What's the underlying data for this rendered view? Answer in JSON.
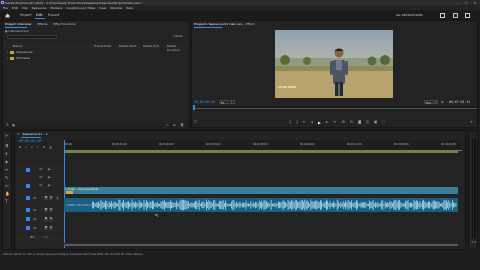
{
  "window": {
    "title": "Adobe Premiere Pro 2023 - C:\\Users\\Lady Productions\\Desktop\\Interview\\Project\\Interview *",
    "minimize": "—",
    "maximize": "☐",
    "close": "✕"
  },
  "menu": [
    "File",
    "Edit",
    "Clip",
    "Sequence",
    "Markers",
    "Graphics and Titles",
    "View",
    "Window",
    "Help"
  ],
  "workspace": {
    "tabs": [
      "Import",
      "Edit",
      "Export"
    ],
    "active": "Edit",
    "project_label": "ALL PRODUCTIONS"
  },
  "project_panel": {
    "tabs": [
      "Project: Interview",
      "Effects",
      "Effect Controls"
    ],
    "project_file": "Interview.prproj",
    "search_placeholder": "",
    "item_count": "2 Items",
    "columns": [
      "Name",
      "Frame Rate",
      "Media Start",
      "Media End",
      "Media Duration"
    ],
    "items": [
      {
        "name": "Sequences"
      },
      {
        "name": "iPhoneAu"
      }
    ]
  },
  "program_monitor": {
    "tab_title": "Program: Sequence 01",
    "tab_menu": "≡",
    "source_tab": "Interview - Effect",
    "timecode_left": "00;00;00;00",
    "fit": "Fit",
    "quality": "Full",
    "timecode_right": "00;07:03:13",
    "overlay_text": "LTTOR HONS"
  },
  "timeline": {
    "tab_title": "Sequence 01",
    "timecode": "00;00;00;00",
    "ruler_marks": [
      "00;00",
      "00;00;32;00",
      "00;01;04;02",
      "00;01;36;02",
      "00;02;08;04",
      "00;02;40;04",
      "00;03;12;06",
      "00;03;44;06",
      "00;04;16;08",
      "00;04;48;08"
    ],
    "tracks": [
      {
        "name": "V3",
        "target": "V3"
      },
      {
        "name": "V2",
        "target": "V2"
      },
      {
        "name": "V1",
        "target": "V1"
      },
      {
        "name": "A1",
        "target": "A1"
      },
      {
        "name": "A2",
        "target": "A2"
      },
      {
        "name": "A3",
        "target": "A3"
      },
      {
        "name": "A4",
        "target": "A4"
      },
      {
        "name": "Mix",
        "target": ""
      }
    ],
    "video_clip_label": "1 Dollar - Interview(2019)",
    "mix_value": "0.0"
  },
  "statusbar": {
    "text": "Click to select, or click in empty space and drag to marquee select. Use Shift, Alt, and Ctrl for other options."
  },
  "colors": {
    "accent": "#2d8ceb",
    "video_clip": "#3a7d98",
    "audio_clip": "#1b5f80",
    "folder": "#c9a33a",
    "audio_waveform": "#a9d7ee"
  }
}
